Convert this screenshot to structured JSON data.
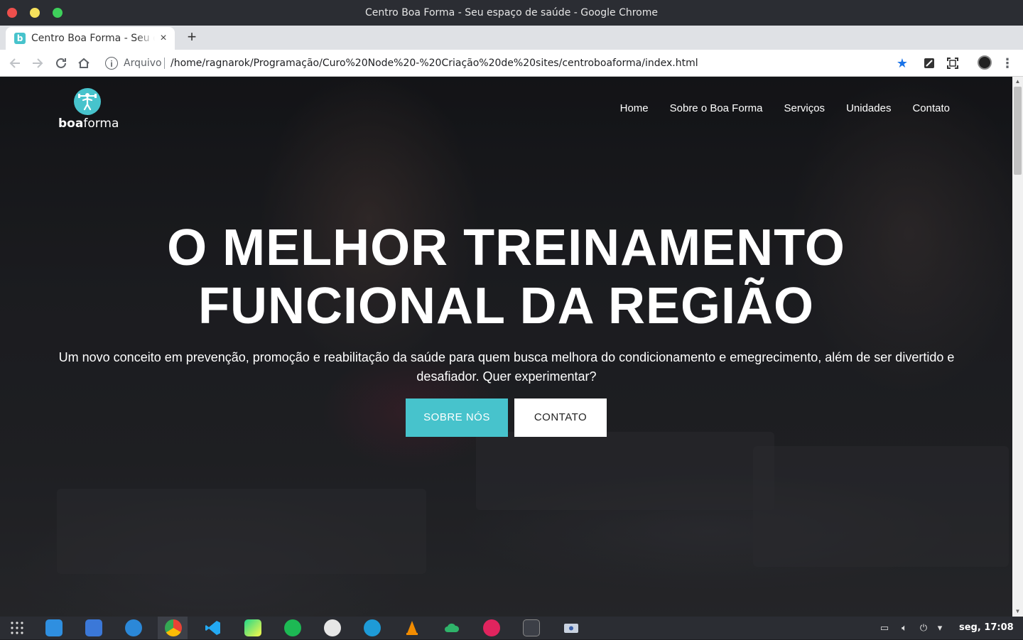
{
  "window": {
    "title": "Centro Boa Forma - Seu espaço de saúde - Google Chrome"
  },
  "tab": {
    "favicon_letter": "b",
    "title": "Centro Boa Forma - Seu espaço de saúde",
    "close_icon": "close-icon"
  },
  "toolbar": {
    "scheme_label": "Arquivo",
    "url": "/home/ragnarok/Programação/Curo%20Node%20-%20Criação%20de%20sites/centroboaforma/index.html"
  },
  "site": {
    "logo": {
      "bold": "boa",
      "regular": "forma"
    },
    "nav": [
      "Home",
      "Sobre o Boa Forma",
      "Serviços",
      "Unidades",
      "Contato"
    ],
    "hero_title_line1": "O MELHOR TREINAMENTO",
    "hero_title_line2": "FUNCIONAL DA REGIÃO",
    "hero_subtitle": "Um novo conceito em prevenção, promoção e reabilitação da saúde para quem busca melhora do condicionamento e emegrecimento, além de ser divertido e desafiador. Quer experimentar?",
    "btn_primary": "SOBRE NÓS",
    "btn_secondary": "CONTATO",
    "accent_color": "#47c3cc"
  },
  "taskbar": {
    "apps": [
      "app-grid",
      "calendar",
      "files",
      "software-center",
      "chrome",
      "vscode",
      "pycharm",
      "spotify",
      "browser",
      "downloader",
      "vlc",
      "cloud",
      "flickr",
      "terminal",
      "screen-recorder"
    ],
    "clock": "seg, 17:08"
  }
}
